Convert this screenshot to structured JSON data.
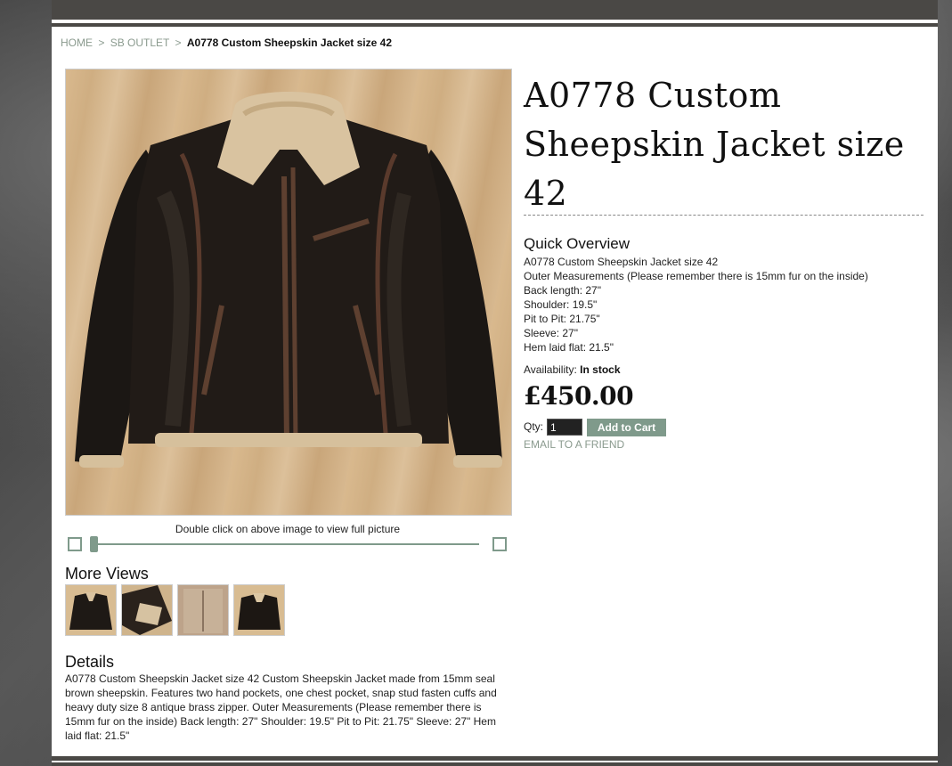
{
  "breadcrumb": {
    "home": "HOME",
    "sep1": ">",
    "category": "SB OUTLET",
    "sep2": ">",
    "current": "A0778 Custom Sheepskin Jacket size 42"
  },
  "product": {
    "name": "A0778 Custom Sheepskin Jacket size 42",
    "image_caption": "Double click on above image to view full picture",
    "more_views_title": "More Views",
    "thumbnails": [
      "jacket-front",
      "jacket-lining",
      "jacket-inside",
      "jacket-front-2"
    ],
    "details_title": "Details",
    "details_text": "A0778 Custom Sheepskin Jacket size 42 Custom Sheepskin Jacket made from 15mm seal brown sheepskin. Features two hand pockets, one chest pocket, snap stud fasten cuffs and heavy duty size 8 antique brass zipper. Outer Measurements (Please remember there is 15mm fur on the inside) Back length: 27\" Shoulder: 19.5\" Pit to Pit: 21.75\" Sleeve: 27\" Hem laid flat: 21.5\""
  },
  "quick_overview": {
    "title": "Quick Overview",
    "lines": [
      "A0778 Custom Sheepskin Jacket size 42",
      "Outer Measurements (Please remember there is 15mm fur on the inside)",
      "Back length: 27\"",
      "Shoulder: 19.5\"",
      "Pit to Pit: 21.75\"",
      "Sleeve: 27\"",
      "Hem laid flat: 21.5\""
    ]
  },
  "availability": {
    "label": "Availability:",
    "value": "In stock"
  },
  "price": "£450.00",
  "cart": {
    "qty_label": "Qty:",
    "qty_value": "1",
    "add_label": "Add to Cart",
    "email_friend": "EMAIL TO A FRIEND"
  },
  "zoom": {
    "level": 0
  },
  "colors": {
    "accent": "#7f9a8b",
    "bar": "#4a4845",
    "link": "#8a9a8e"
  }
}
